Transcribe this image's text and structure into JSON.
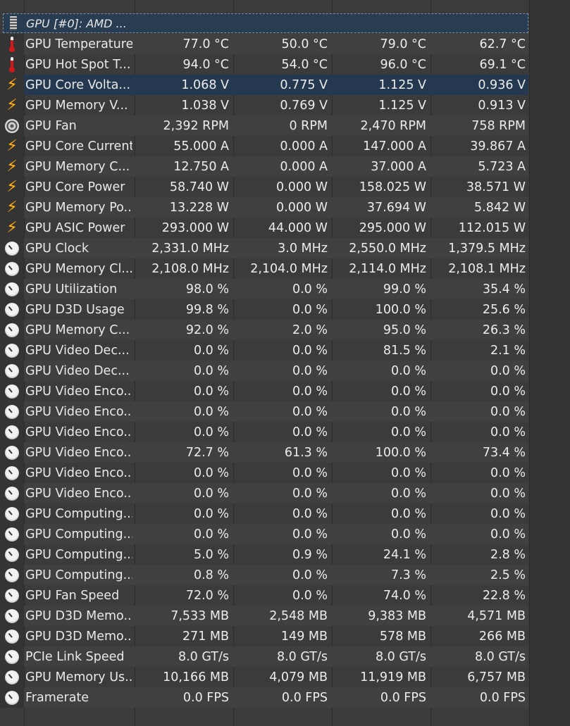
{
  "group": {
    "label": "GPU [#0]: AMD ...",
    "icon": "chip-icon"
  },
  "rows": [
    {
      "label": "GPU Temperature",
      "icon": "thermometer-icon",
      "values": [
        "77.0 °C",
        "50.0 °C",
        "79.0 °C",
        "62.7 °C"
      ]
    },
    {
      "label": "GPU Hot Spot T...",
      "icon": "thermometer-icon",
      "values": [
        "94.0 °C",
        "54.0 °C",
        "96.0 °C",
        "69.1 °C"
      ]
    },
    {
      "label": "GPU Core Volta...",
      "icon": "lightning-icon",
      "values": [
        "1.068 V",
        "0.775 V",
        "1.125 V",
        "0.936 V"
      ]
    },
    {
      "label": "GPU Memory V...",
      "icon": "lightning-icon",
      "values": [
        "1.038 V",
        "0.769 V",
        "1.125 V",
        "0.913 V"
      ]
    },
    {
      "label": "GPU Fan",
      "icon": "fan-icon",
      "values": [
        "2,392 RPM",
        "0 RPM",
        "2,470 RPM",
        "758 RPM"
      ]
    },
    {
      "label": "GPU Core Current",
      "icon": "lightning-icon",
      "values": [
        "55.000 A",
        "0.000 A",
        "147.000 A",
        "39.867 A"
      ]
    },
    {
      "label": "GPU Memory C...",
      "icon": "lightning-icon",
      "values": [
        "12.750 A",
        "0.000 A",
        "37.000 A",
        "5.723 A"
      ]
    },
    {
      "label": "GPU Core Power",
      "icon": "lightning-icon",
      "values": [
        "58.740 W",
        "0.000 W",
        "158.025 W",
        "38.571 W"
      ]
    },
    {
      "label": "GPU Memory Po...",
      "icon": "lightning-icon",
      "values": [
        "13.228 W",
        "0.000 W",
        "37.694 W",
        "5.842 W"
      ]
    },
    {
      "label": "GPU ASIC Power",
      "icon": "lightning-icon",
      "values": [
        "293.000 W",
        "44.000 W",
        "295.000 W",
        "112.015 W"
      ]
    },
    {
      "label": "GPU Clock",
      "icon": "gauge-icon",
      "values": [
        "2,331.0 MHz",
        "3.0 MHz",
        "2,550.0 MHz",
        "1,379.5 MHz"
      ]
    },
    {
      "label": "GPU Memory Cl...",
      "icon": "gauge-icon",
      "values": [
        "2,108.0 MHz",
        "2,104.0 MHz",
        "2,114.0 MHz",
        "2,108.1 MHz"
      ]
    },
    {
      "label": "GPU Utilization",
      "icon": "gauge-icon",
      "values": [
        "98.0 %",
        "0.0 %",
        "99.0 %",
        "35.4 %"
      ]
    },
    {
      "label": "GPU D3D Usage",
      "icon": "gauge-icon",
      "values": [
        "99.8 %",
        "0.0 %",
        "100.0 %",
        "25.6 %"
      ]
    },
    {
      "label": "GPU Memory C...",
      "icon": "gauge-icon",
      "values": [
        "92.0 %",
        "2.0 %",
        "95.0 %",
        "26.3 %"
      ]
    },
    {
      "label": "GPU Video Dec...",
      "icon": "gauge-icon",
      "values": [
        "0.0 %",
        "0.0 %",
        "81.5 %",
        "2.1 %"
      ]
    },
    {
      "label": "GPU Video Dec...",
      "icon": "gauge-icon",
      "values": [
        "0.0 %",
        "0.0 %",
        "0.0 %",
        "0.0 %"
      ]
    },
    {
      "label": "GPU Video Enco...",
      "icon": "gauge-icon",
      "values": [
        "0.0 %",
        "0.0 %",
        "0.0 %",
        "0.0 %"
      ]
    },
    {
      "label": "GPU Video Enco...",
      "icon": "gauge-icon",
      "values": [
        "0.0 %",
        "0.0 %",
        "0.0 %",
        "0.0 %"
      ]
    },
    {
      "label": "GPU Video Enco...",
      "icon": "gauge-icon",
      "values": [
        "0.0 %",
        "0.0 %",
        "0.0 %",
        "0.0 %"
      ]
    },
    {
      "label": "GPU Video Enco...",
      "icon": "gauge-icon",
      "values": [
        "72.7 %",
        "61.3 %",
        "100.0 %",
        "73.4 %"
      ]
    },
    {
      "label": "GPU Video Enco...",
      "icon": "gauge-icon",
      "values": [
        "0.0 %",
        "0.0 %",
        "0.0 %",
        "0.0 %"
      ]
    },
    {
      "label": "GPU Video Enco...",
      "icon": "gauge-icon",
      "values": [
        "0.0 %",
        "0.0 %",
        "0.0 %",
        "0.0 %"
      ]
    },
    {
      "label": "GPU Computing...",
      "icon": "gauge-icon",
      "values": [
        "0.0 %",
        "0.0 %",
        "0.0 %",
        "0.0 %"
      ]
    },
    {
      "label": "GPU Computing...",
      "icon": "gauge-icon",
      "values": [
        "0.0 %",
        "0.0 %",
        "0.0 %",
        "0.0 %"
      ]
    },
    {
      "label": "GPU Computing...",
      "icon": "gauge-icon",
      "values": [
        "5.0 %",
        "0.9 %",
        "24.1 %",
        "2.8 %"
      ]
    },
    {
      "label": "GPU Computing...",
      "icon": "gauge-icon",
      "values": [
        "0.8 %",
        "0.0 %",
        "7.3 %",
        "2.5 %"
      ]
    },
    {
      "label": "GPU Fan Speed",
      "icon": "gauge-icon",
      "values": [
        "72.0 %",
        "0.0 %",
        "74.0 %",
        "22.8 %"
      ]
    },
    {
      "label": "GPU D3D Memo...",
      "icon": "gauge-icon",
      "values": [
        "7,533 MB",
        "2,548 MB",
        "9,383 MB",
        "4,571 MB"
      ]
    },
    {
      "label": "GPU D3D Memo...",
      "icon": "gauge-icon",
      "values": [
        "271 MB",
        "149 MB",
        "578 MB",
        "266 MB"
      ]
    },
    {
      "label": "PCIe Link Speed",
      "icon": "gauge-icon",
      "values": [
        "8.0 GT/s",
        "8.0 GT/s",
        "8.0 GT/s",
        "8.0 GT/s"
      ]
    },
    {
      "label": "GPU Memory Us...",
      "icon": "gauge-icon",
      "values": [
        "10,166 MB",
        "4,079 MB",
        "11,919 MB",
        "6,757 MB"
      ]
    },
    {
      "label": "Framerate",
      "icon": "gauge-icon",
      "values": [
        "0.0 FPS",
        "0.0 FPS",
        "0.0 FPS",
        "0.0 FPS"
      ]
    }
  ],
  "selected_row_index": 2,
  "colors": {
    "background": "#3b3b3b",
    "row_alt": "#404040",
    "selection": "#24394f",
    "text": "#ececec",
    "lightning": "#ffb21b",
    "thermometer": "#d01a1a"
  }
}
